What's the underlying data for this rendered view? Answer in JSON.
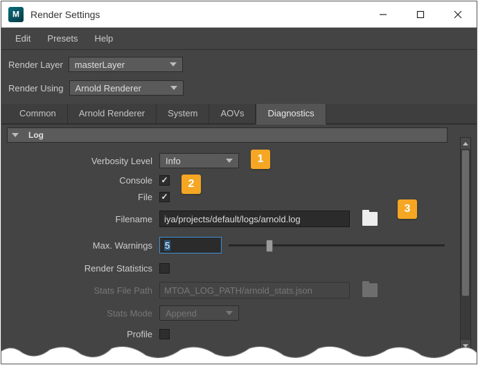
{
  "window": {
    "title": "Render Settings"
  },
  "menubar": [
    "Edit",
    "Presets",
    "Help"
  ],
  "render_layer": {
    "label": "Render Layer",
    "value": "masterLayer"
  },
  "render_using": {
    "label": "Render Using",
    "value": "Arnold Renderer"
  },
  "tabs": [
    "Common",
    "Arnold Renderer",
    "System",
    "AOVs",
    "Diagnostics"
  ],
  "active_tab": "Diagnostics",
  "section": {
    "title": "Log"
  },
  "fields": {
    "verbosity": {
      "label": "Verbosity Level",
      "value": "Info"
    },
    "console": {
      "label": "Console",
      "checked": true
    },
    "file": {
      "label": "File",
      "checked": true
    },
    "filename": {
      "label": "Filename",
      "value": "iya/projects/default/logs/arnold.log"
    },
    "max_warnings": {
      "label": "Max. Warnings",
      "value": "5"
    },
    "render_stats": {
      "label": "Render Statistics",
      "checked": false
    },
    "stats_file_path": {
      "label": "Stats File Path",
      "value": "MTOA_LOG_PATH/arnold_stats.json"
    },
    "stats_mode": {
      "label": "Stats Mode",
      "value": "Append"
    },
    "profile": {
      "label": "Profile",
      "checked": false
    }
  },
  "callouts": {
    "c1": "1",
    "c2": "2",
    "c3": "3"
  }
}
